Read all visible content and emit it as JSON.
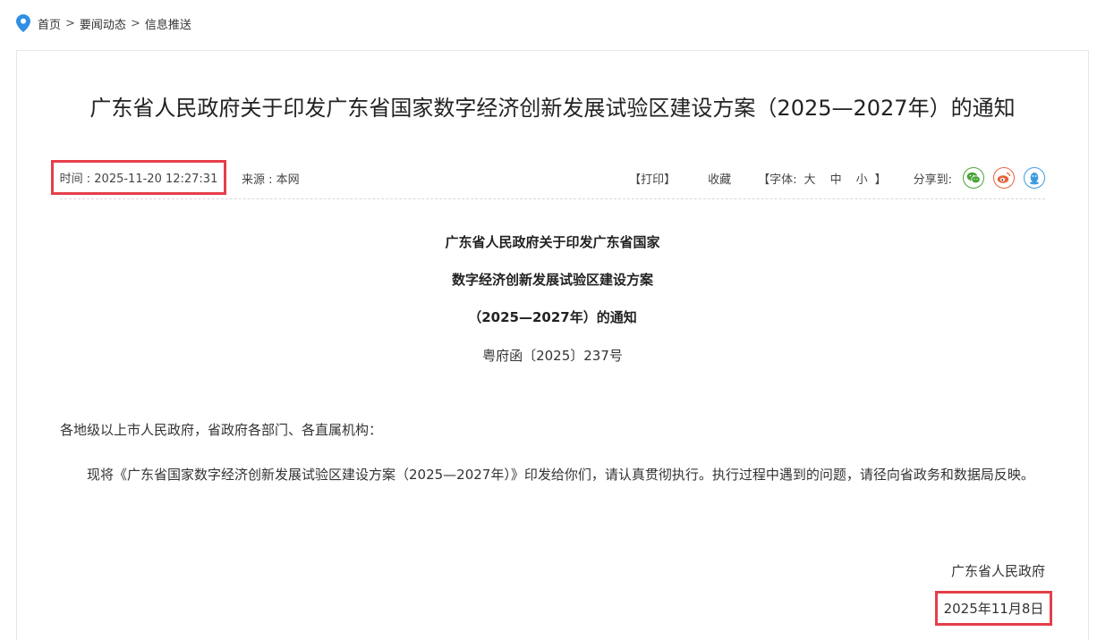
{
  "breadcrumb": {
    "items": [
      "首页",
      "要闻动态",
      "信息推送"
    ],
    "separator": ">"
  },
  "article": {
    "title": "广东省人民政府关于印发广东省国家数字经济创新发展试验区建设方案（2025—2027年）的通知",
    "time_label": "时间 : 2025-11-20 12:27:31",
    "source_label": "来源 : 本网",
    "tools": {
      "print": "【打印】",
      "favorite": "收藏",
      "font_prefix": "【字体:",
      "font_large": "大",
      "font_medium": "中",
      "font_small": "小",
      "font_suffix": "】",
      "share_label": "分享到:"
    },
    "share_icons": [
      "wechat-icon",
      "weibo-icon",
      "qq-icon"
    ],
    "doc_heading": [
      "广东省人民政府关于印发广东省国家",
      "数字经济创新发展试验区建设方案",
      "（2025—2027年）的通知"
    ],
    "doc_number": "粤府函〔2025〕237号",
    "salutation": "各地级以上市人民政府，省政府各部门、各直属机构：",
    "paragraph": "现将《广东省国家数字经济创新发展试验区建设方案（2025—2027年）》印发给你们，请认真贯彻执行。执行过程中遇到的问题，请径向省政务和数据局反映。",
    "signature_org": "广东省人民政府",
    "signature_date": "2025年11月8日"
  },
  "colors": {
    "highlight_border": "#e53e4a",
    "location_pin": "#2f8fe6",
    "wechat": "#4aa536",
    "weibo": "#e8633a",
    "qq": "#3b9be0"
  }
}
